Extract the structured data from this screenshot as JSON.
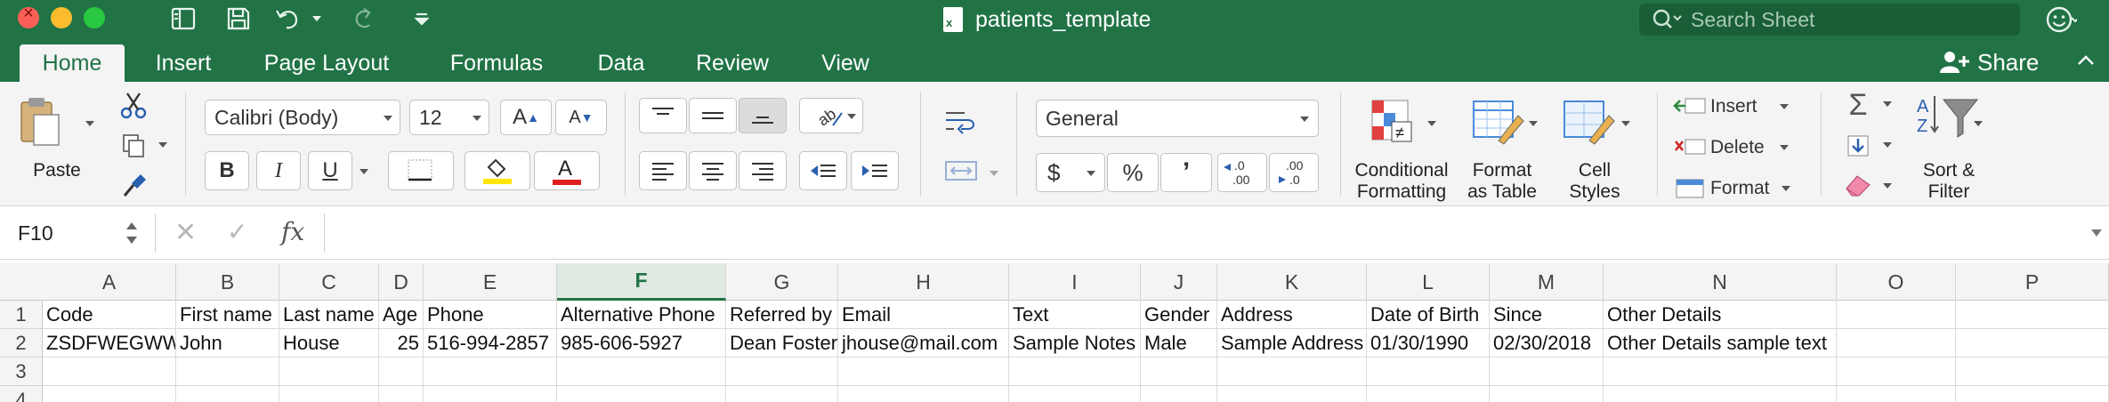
{
  "window": {
    "title": "patients_template",
    "search_placeholder": "Search Sheet"
  },
  "tabs": [
    {
      "label": "Home",
      "active": true
    },
    {
      "label": "Insert"
    },
    {
      "label": "Page Layout"
    },
    {
      "label": "Formulas"
    },
    {
      "label": "Data"
    },
    {
      "label": "Review"
    },
    {
      "label": "View"
    }
  ],
  "share_label": "Share",
  "ribbon": {
    "paste_label": "Paste",
    "font_name": "Calibri (Body)",
    "font_size": "12",
    "bold": "B",
    "italic": "I",
    "underline": "U",
    "number_format": "General",
    "currency": "$",
    "percent": "%",
    "comma": "’",
    "inc_decimal": ".0\n.00",
    "dec_decimal": ".00\n.0",
    "conditional_formatting": [
      "Conditional",
      "Formatting"
    ],
    "format_as_table": [
      "Format",
      "as Table"
    ],
    "cell_styles": [
      "Cell",
      "Styles"
    ],
    "insert_label": "Insert",
    "delete_label": "Delete",
    "format_label": "Format",
    "sort_filter": [
      "Sort &",
      "Filter"
    ]
  },
  "formula_bar": {
    "name_box": "F10",
    "formula": ""
  },
  "grid": {
    "selected_column": "F",
    "columns": [
      "A",
      "B",
      "C",
      "D",
      "E",
      "F",
      "G",
      "H",
      "I",
      "J",
      "K",
      "L",
      "M",
      "N",
      "O",
      "P"
    ],
    "rows": [
      "1",
      "2",
      "3",
      "4"
    ],
    "data": [
      [
        "Code",
        "First name",
        "Last name",
        "Age",
        "Phone",
        "Alternative Phone",
        "Referred by",
        "Email",
        "Text",
        "Gender",
        "Address",
        "Date of Birth",
        "Since",
        "Other Details",
        "",
        ""
      ],
      [
        "ZSDFWEGWW",
        "John",
        "House",
        "25",
        "516-994-2857",
        "985-606-5927",
        "Dean Foster",
        "jhouse@mail.com",
        "Sample Notes",
        "Male",
        "Sample Address",
        "01/30/1990",
        "02/30/2018",
        "Other Details sample text",
        "",
        ""
      ],
      [
        "",
        "",
        "",
        "",
        "",
        "",
        "",
        "",
        "",
        "",
        "",
        "",
        "",
        "",
        "",
        ""
      ],
      [
        "",
        "",
        "",
        "",
        "",
        "",
        "",
        "",
        "",
        "",
        "",
        "",
        "",
        "",
        "",
        ""
      ]
    ],
    "numeric_cells": [
      [
        1,
        3
      ]
    ]
  },
  "colors": {
    "brand_green": "#217346",
    "highlight_yellow": "#ffe600",
    "font_red": "#e02020"
  }
}
